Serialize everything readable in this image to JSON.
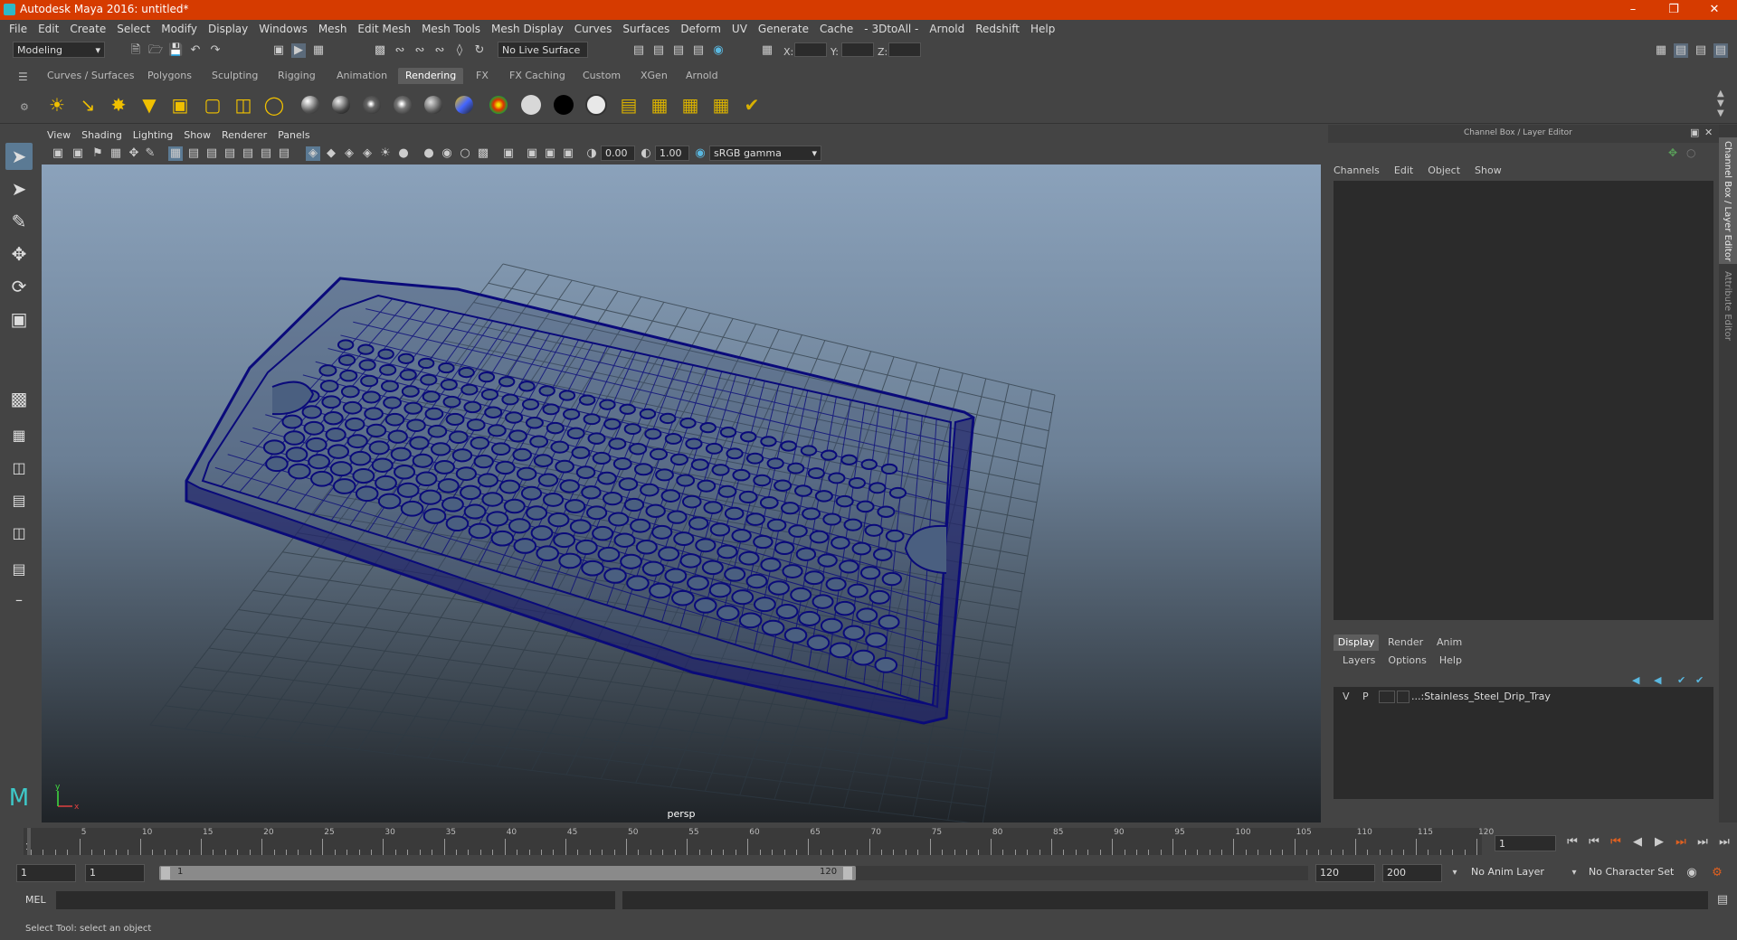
{
  "app": {
    "title": "Autodesk Maya 2016: untitled*"
  },
  "menubar": [
    "File",
    "Edit",
    "Create",
    "Select",
    "Modify",
    "Display",
    "Windows",
    "Mesh",
    "Edit Mesh",
    "Mesh Tools",
    "Mesh Display",
    "Curves",
    "Surfaces",
    "Deform",
    "UV",
    "Generate",
    "Cache",
    "- 3DtoAll -",
    "Arnold",
    "Redshift",
    "Help"
  ],
  "statusline": {
    "mode": "Modeling",
    "live_surface": "No Live Surface",
    "x_label": "X:",
    "y_label": "Y:",
    "z_label": "Z:"
  },
  "shelf_tabs": [
    "Curves / Surfaces",
    "Polygons",
    "Sculpting",
    "Rigging",
    "Animation",
    "Rendering",
    "FX",
    "FX Caching",
    "Custom",
    "XGen",
    "Arnold"
  ],
  "shelf_active": "Rendering",
  "viewport": {
    "menu": [
      "View",
      "Shading",
      "Lighting",
      "Show",
      "Renderer",
      "Panels"
    ],
    "exposure": "0.00",
    "gamma": "1.00",
    "colorspace": "sRGB gamma",
    "camera_label": "persp",
    "axis_x": "x",
    "axis_y": "y"
  },
  "channel_box": {
    "title": "Channel Box / Layer Editor",
    "menu": [
      "Channels",
      "Edit",
      "Object",
      "Show"
    ]
  },
  "layer_editor": {
    "tabs": [
      "Display",
      "Render",
      "Anim"
    ],
    "menu": [
      "Layers",
      "Options",
      "Help"
    ],
    "layer": {
      "v": "V",
      "p": "P",
      "name": "...:Stainless_Steel_Drip_Tray"
    }
  },
  "side_tabs": [
    "Channel Box / Layer Editor",
    "Attribute Editor"
  ],
  "timeline": {
    "ticks": [
      "5",
      "10",
      "15",
      "20",
      "25",
      "30",
      "35",
      "40",
      "45",
      "50",
      "55",
      "60",
      "65",
      "70",
      "75",
      "80",
      "85",
      "90",
      "95",
      "100",
      "105",
      "110",
      "115",
      "120"
    ],
    "current_frame_marker": "1",
    "current_frame": "1"
  },
  "range": {
    "start": "1",
    "playback_start": "1",
    "slider_start": "1",
    "slider_end": "120",
    "playback_end": "120",
    "end": "200",
    "anim_layer": "No Anim Layer",
    "char_set": "No Character Set"
  },
  "mel": {
    "label": "MEL"
  },
  "help_line": "Select Tool: select an object",
  "colors": {
    "titlebar": "#d63b00",
    "active_tab": "#5d5d5d",
    "wireframe": "#0a0a7a"
  }
}
